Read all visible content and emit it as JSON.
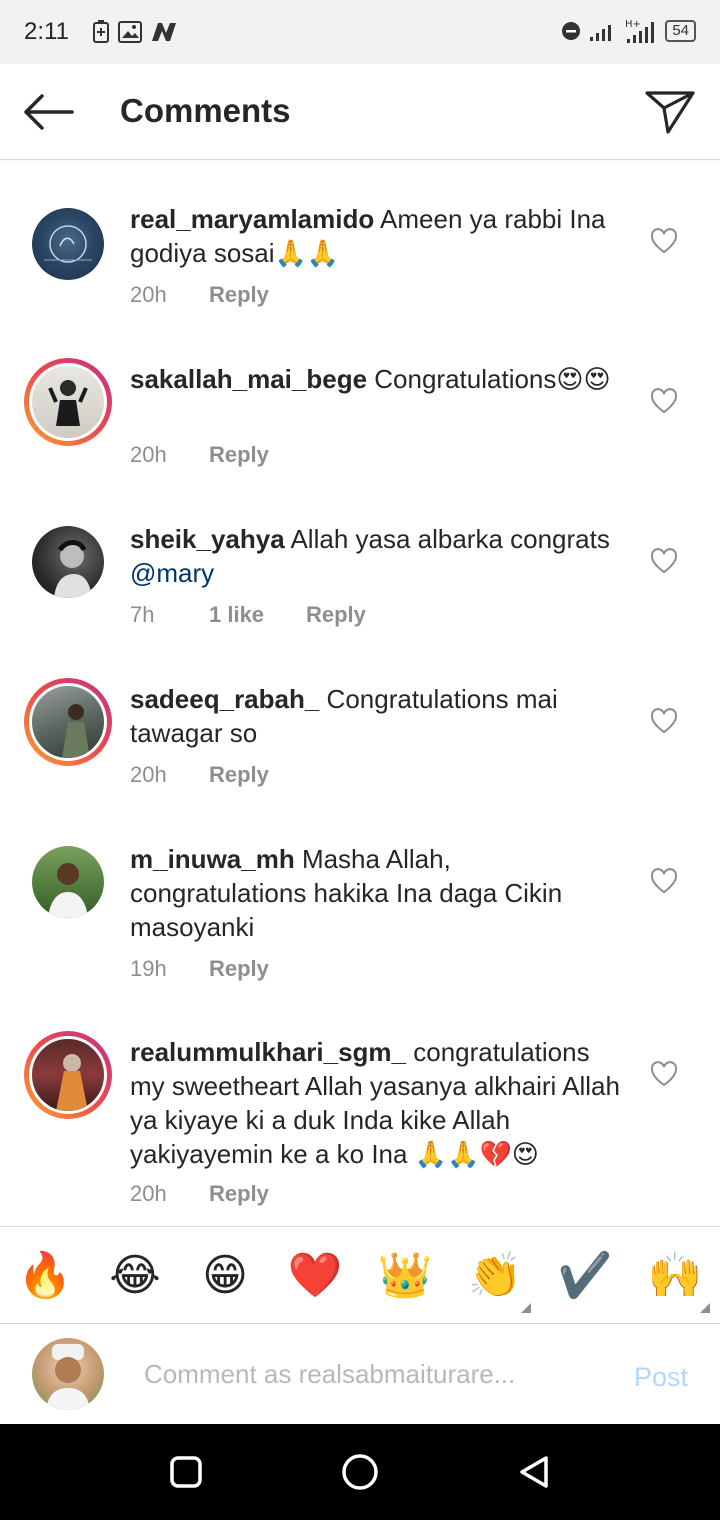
{
  "status_bar": {
    "time": "2:11",
    "battery": "54",
    "network": "H+"
  },
  "header": {
    "title": "Comments"
  },
  "comments": [
    {
      "username": "real_maryamlamido",
      "text": " Ameen ya rabbi Ina godiya sosai🙏🙏",
      "time": "20h",
      "likes": "",
      "reply": "Reply"
    },
    {
      "username": "sakallah_mai_bege",
      "text": " Congratulations😍😍",
      "time": "20h",
      "likes": "",
      "reply": "Reply"
    },
    {
      "username": "sheik_yahya",
      "text": " Allah yasa albarka congrats ",
      "mention": "@mary",
      "time": "7h",
      "likes": "1 like",
      "reply": "Reply"
    },
    {
      "username": "sadeeq_rabah_",
      "text": " Congratulations mai tawagar so",
      "time": "20h",
      "likes": "",
      "reply": "Reply"
    },
    {
      "username": "m_inuwa_mh",
      "text": " Masha Allah, congratulations  hakika Ina daga Cikin masoyanki",
      "time": "19h",
      "likes": "",
      "reply": "Reply"
    },
    {
      "username": "realummulkhari_sgm_",
      "text": " congratulations my sweetheart Allah yasanya alkhairi Allah ya kiyaye ki a duk Inda kike Allah yakiyayemin ke a ko Ina 🙏🙏💔😍",
      "time": "20h",
      "likes": "",
      "reply": "Reply"
    }
  ],
  "emoji_bar": [
    "🔥",
    "😂",
    "😁",
    "❤️",
    "👑",
    "👏",
    "✔️",
    "🙌"
  ],
  "input": {
    "placeholder": "Comment as realsabmaiturare...",
    "value": "",
    "post_label": "Post"
  },
  "colors": {
    "link": "#003569",
    "post_disabled": "#b3d7f8",
    "meta": "#8e8e8e",
    "story_ring": "#ee4b4b"
  }
}
